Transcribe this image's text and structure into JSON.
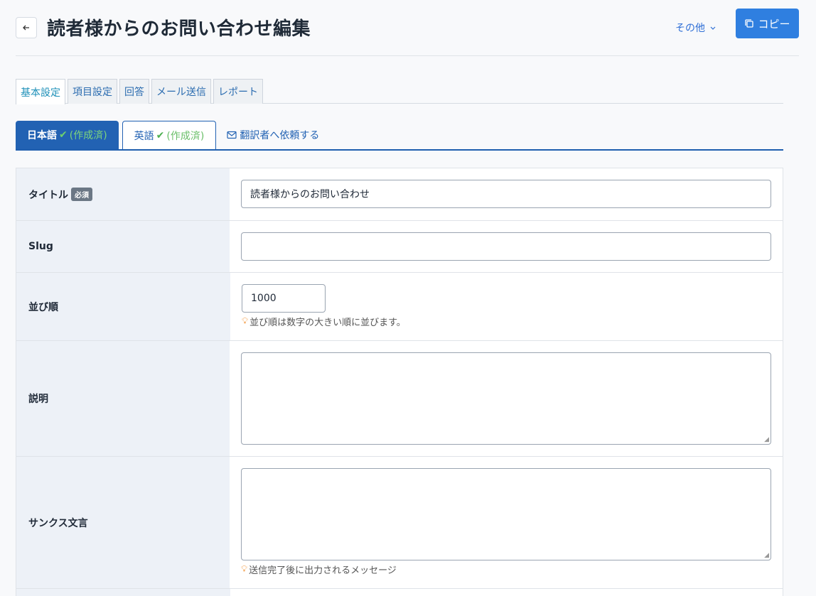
{
  "header": {
    "title": "読者様からのお問い合わせ編集",
    "more_label": "その他",
    "copy_label": "コピー"
  },
  "tabs": [
    {
      "label": "基本設定",
      "active": true
    },
    {
      "label": "項目設定",
      "active": false
    },
    {
      "label": "回答",
      "active": false
    },
    {
      "label": "メール送信",
      "active": false
    },
    {
      "label": "レポート",
      "active": false
    }
  ],
  "languages": {
    "japanese": {
      "label": "日本語",
      "status": "(作成済)"
    },
    "english": {
      "label": "英語",
      "status": "(作成済)"
    },
    "request_label": "翻訳者へ依頼する"
  },
  "form": {
    "title": {
      "label": "タイトル",
      "required_badge": "必須",
      "value": "読者様からのお問い合わせ"
    },
    "slug": {
      "label": "Slug",
      "value": ""
    },
    "order": {
      "label": "並び順",
      "value": "1000",
      "hint": "並び順は数字の大きい順に並びます。"
    },
    "description": {
      "label": "説明",
      "value": ""
    },
    "thanks": {
      "label": "サンクス文言",
      "value": "",
      "hint": "送信完了後に出力されるメッセージ"
    }
  },
  "colors": {
    "primary": "#2f7fe0",
    "lang_active": "#2262b3",
    "check": "#4caf50",
    "hint_icon": "#f08a24"
  }
}
